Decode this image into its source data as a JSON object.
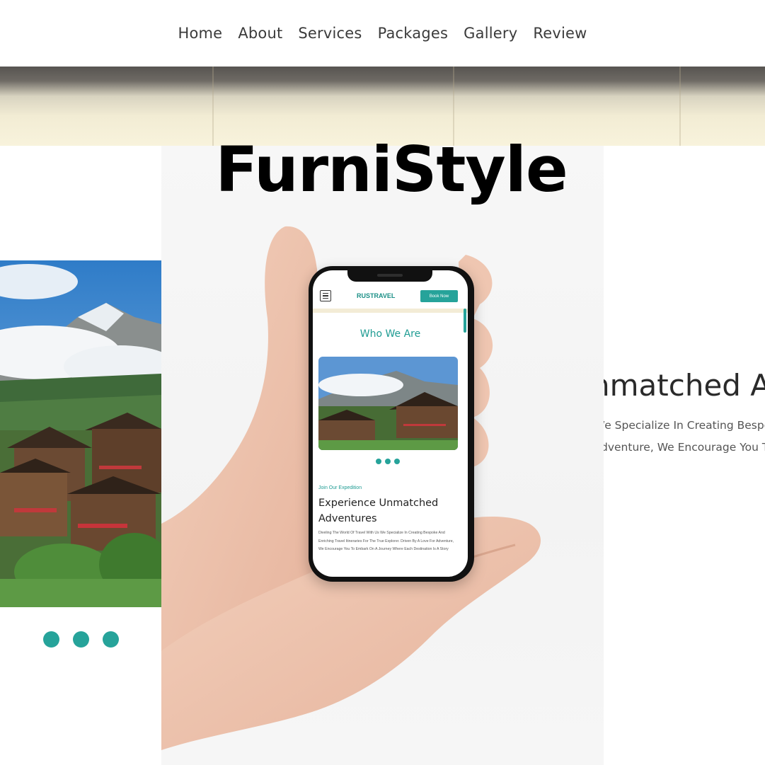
{
  "nav": {
    "items": [
      "Home",
      "About",
      "Services",
      "Packages",
      "Gallery",
      "Review"
    ]
  },
  "hero": {
    "brand": "FurniStyle"
  },
  "phone_screen": {
    "logo": "RUSTRAVEL",
    "book_button": "Book Now",
    "heading": "Who We Are",
    "kicker": "Join Our Expedition",
    "title": "Experience Unmatched Adventures",
    "body": "Diveling The World Of Travel With Us We Specialize In Creating Bespoke And Enriching Travel Itineraries For The True Explorer. Driven By A Love For Adventure, We Encourage You To Embark On A Journey Where Each Destination Is A Story"
  },
  "right_text": {
    "heading": "nmatched A",
    "line1": "/e Specialize In Creating Bespoke",
    "line2": "dventure, We Encourage You To"
  },
  "colors": {
    "accent": "#26a39a",
    "text": "#3b3b3b"
  },
  "icons": {
    "menu": "hamburger-icon"
  }
}
